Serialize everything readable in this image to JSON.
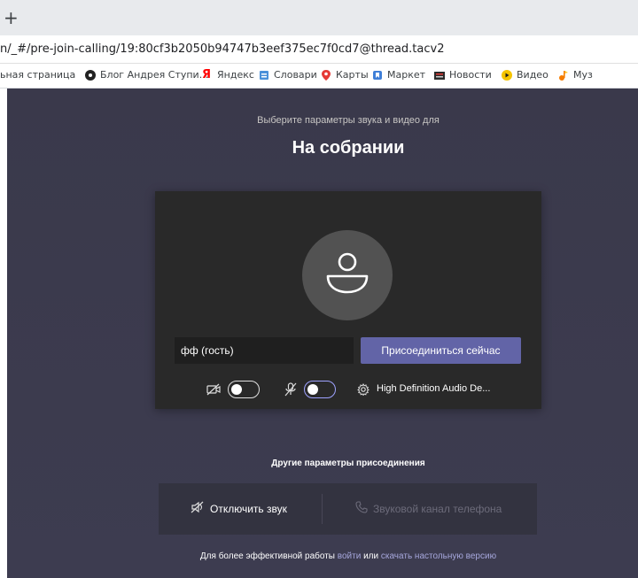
{
  "browser": {
    "new_tab_glyph": "+",
    "url": "n/_#/pre-join-calling/19:80cf3b2050b94747b3eef375ec7f0cd7@thread.tacv2",
    "bookmarks": [
      {
        "label": "ьная страница",
        "icon": "none"
      },
      {
        "label": "Блог Андрея Ступи...",
        "icon": "disc-icon"
      },
      {
        "label": "Яндекс",
        "icon": "yandex-icon"
      },
      {
        "label": "Словари",
        "icon": "dictionary-icon"
      },
      {
        "label": "Карты",
        "icon": "map-pin-icon"
      },
      {
        "label": "Маркет",
        "icon": "market-icon"
      },
      {
        "label": "Новости",
        "icon": "news-icon"
      },
      {
        "label": "Видео",
        "icon": "video-icon"
      },
      {
        "label": "Муз",
        "icon": "music-icon"
      }
    ]
  },
  "prejoin": {
    "subtitle": "Выберите параметры звука и видео для",
    "meeting_title": "На собрании",
    "name_value": "фф (гость)",
    "join_label": "Присоединиться сейчас",
    "camera_toggle": {
      "state": "off"
    },
    "mic_toggle": {
      "state": "off"
    },
    "audio_device": "High Definition Audio De...",
    "other_options_title": "Другие параметры присоединения",
    "mute_audio_label": "Отключить звук",
    "phone_audio_label": "Звуковой канал телефона",
    "footer_prefix": "Для более эффективной работы",
    "footer_signin": "войти",
    "footer_or": "или",
    "footer_download": "скачать настольную версию"
  },
  "colors": {
    "background": "#3b3a4e",
    "card": "#292929",
    "accent": "#6264a7",
    "link": "#a6a7dc"
  }
}
